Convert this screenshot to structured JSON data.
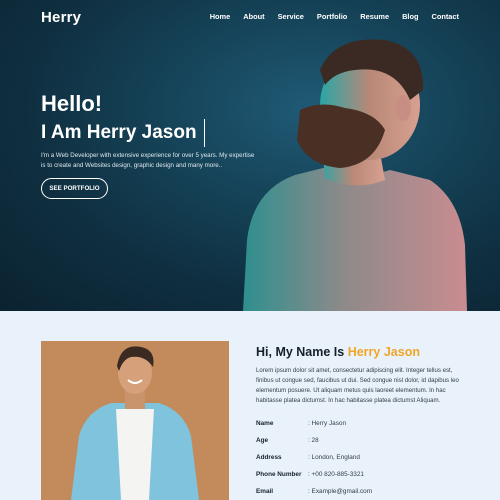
{
  "brand": "Herry",
  "nav": [
    "Home",
    "About",
    "Service",
    "Portfolio",
    "Resume",
    "Blog",
    "Contact"
  ],
  "hero": {
    "greeting": "Hello!",
    "headline": "I Am Herry Jason",
    "description": "I'm a Web Developer with extensive experience for over 5 years. My expertise is to create and Websites design, graphic design and many more..",
    "cta": "SEE PORTFOLIO"
  },
  "about": {
    "heading_prefix": "Hi, My Name Is ",
    "heading_name": "Herry Jason",
    "paragraph": "Lorem ipsum dolor sit amet, consectetur adipiscing elit. Integer tellus est, finibus ut congue sed, faucibus ut dui. Sed congue nisl dolor, id dapibus leo elementum posuere. Ut aliquam metus quis laoreet elementum. In hac habitasse platea dictumst. In hac habitasse platea dictumst Aliquam.",
    "info": [
      {
        "label": "Name",
        "value": ": Herry Jason"
      },
      {
        "label": "Age",
        "value": ": 28"
      },
      {
        "label": "Address",
        "value": ": London, England"
      },
      {
        "label": "Phone Number",
        "value": ": +00 820-885-3321"
      },
      {
        "label": "Email",
        "value": ": Example@gmail.com"
      }
    ]
  },
  "colors": {
    "hero_bg": "#154257",
    "accent": "#f0a526",
    "about_bg": "#e9f2fb"
  }
}
